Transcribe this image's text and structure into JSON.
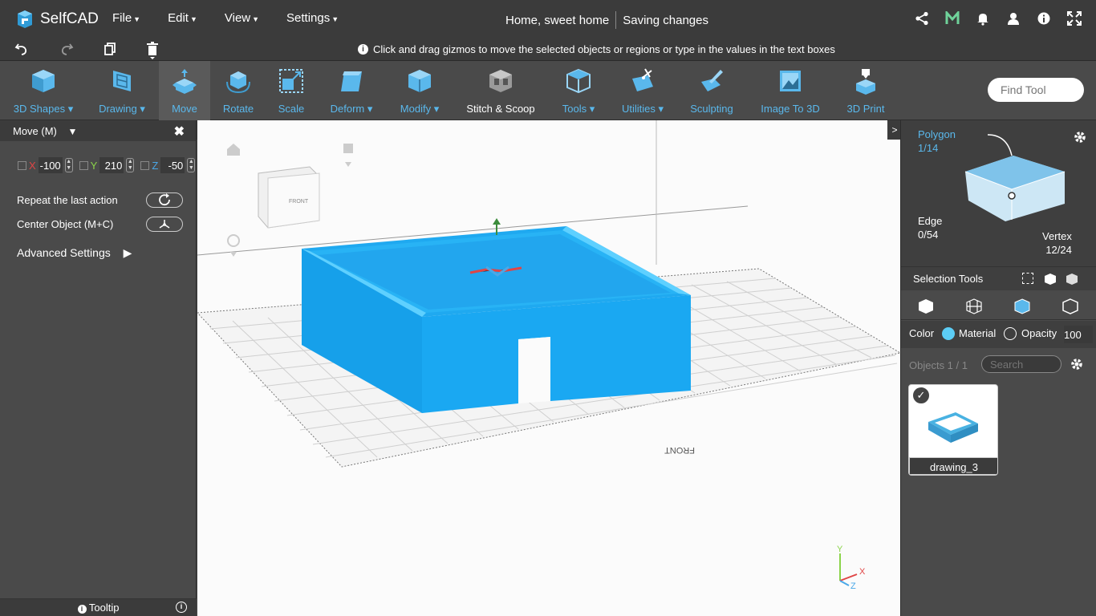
{
  "app": {
    "name": "SelfCAD",
    "project_title": "Home, sweet home",
    "save_status": "Saving changes"
  },
  "menu": [
    {
      "label": "File"
    },
    {
      "label": "Edit"
    },
    {
      "label": "View"
    },
    {
      "label": "Settings"
    }
  ],
  "hint": "Click and drag gizmos to move the selected objects or regions or type in the values in the text boxes",
  "toolbar": [
    {
      "label": "3D Shapes",
      "icon": "cube-icon",
      "dropdown": true
    },
    {
      "label": "Drawing",
      "icon": "drawing-icon",
      "dropdown": true
    },
    {
      "label": "Move",
      "icon": "move-icon",
      "active": true
    },
    {
      "label": "Rotate",
      "icon": "rotate-icon"
    },
    {
      "label": "Scale",
      "icon": "scale-icon"
    },
    {
      "label": "Deform",
      "icon": "deform-icon",
      "dropdown": true
    },
    {
      "label": "Modify",
      "icon": "modify-icon",
      "dropdown": true
    },
    {
      "label": "Stitch & Scoop",
      "icon": "stitch-scoop-icon"
    },
    {
      "label": "Tools",
      "icon": "tools-icon",
      "dropdown": true
    },
    {
      "label": "Utilities",
      "icon": "utilities-icon",
      "dropdown": true
    },
    {
      "label": "Sculpting",
      "icon": "sculpting-icon"
    },
    {
      "label": "Image To 3D",
      "icon": "image-to-3d-icon"
    },
    {
      "label": "3D Print",
      "icon": "3d-print-icon"
    }
  ],
  "find_tool": {
    "placeholder": "Find Tool"
  },
  "left_panel": {
    "title": "Move (M)",
    "x": {
      "label": "X",
      "value": "-100"
    },
    "y": {
      "label": "Y",
      "value": "210"
    },
    "z": {
      "label": "Z",
      "value": "-50"
    },
    "repeat_label": "Repeat the last action",
    "center_label": "Center Object (M+C)",
    "advanced_label": "Advanced Settings",
    "tooltip_label": "Tooltip"
  },
  "viewcube": {
    "front_label": "FRONT"
  },
  "grid_label": "FRONT",
  "right_panel": {
    "polygon": {
      "label": "Polygon",
      "count": "1/14"
    },
    "edge": {
      "label": "Edge",
      "count": "0/54"
    },
    "vertex": {
      "label": "Vertex",
      "count": "12/24"
    },
    "selection_tools_label": "Selection Tools",
    "color_label": "Color",
    "material_label": "Material",
    "opacity_label": "Opacity",
    "opacity_value": "100",
    "objects_label": "Objects 1 / 1",
    "search_placeholder": "Search",
    "object_name": "drawing_3"
  },
  "axis": {
    "x": "X",
    "y": "Y",
    "z": "Z"
  },
  "colors": {
    "accent": "#5ab8ec",
    "model": "#1fa9f0",
    "topbar": "#3b3b3b"
  }
}
